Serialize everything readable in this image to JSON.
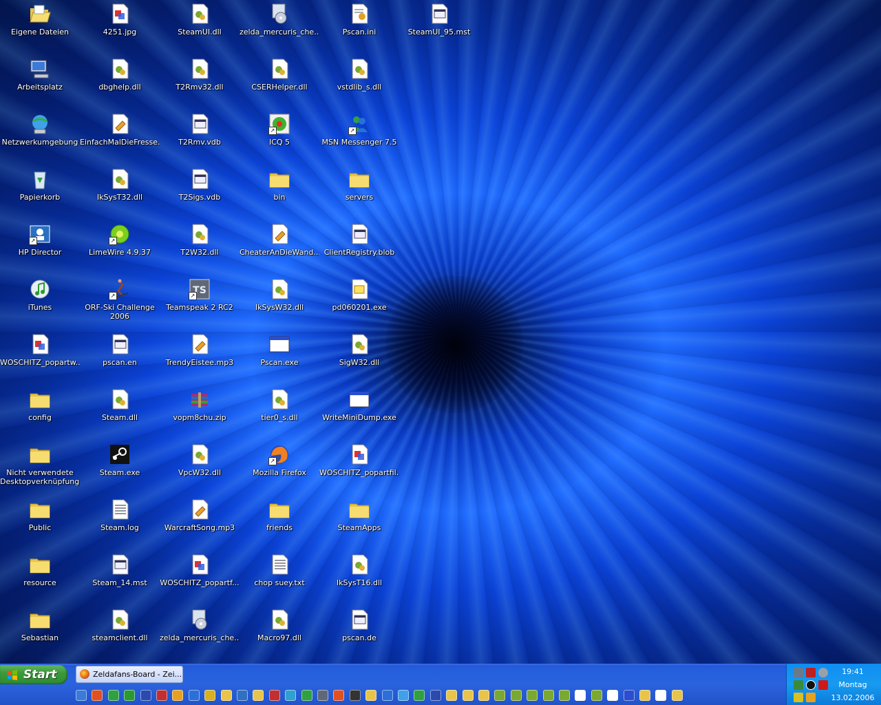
{
  "desktop": {
    "icons": [
      {
        "label": "Eigene Dateien",
        "kind": "folder-open-icon"
      },
      {
        "label": "4251.jpg",
        "kind": "image-file-icon"
      },
      {
        "label": "SteamUI.dll",
        "kind": "dll-file-icon"
      },
      {
        "label": "zelda_mercuris_che...",
        "kind": "installer-icon"
      },
      {
        "label": "Pscan.ini",
        "kind": "ini-file-icon"
      },
      {
        "label": "SteamUI_95.mst",
        "kind": "generic-file-icon"
      },
      {
        "label": "Arbeitsplatz",
        "kind": "my-computer-icon"
      },
      {
        "label": "dbghelp.dll",
        "kind": "dll-file-icon"
      },
      {
        "label": "T2Rmv32.dll",
        "kind": "dll-file-icon"
      },
      {
        "label": "CSERHelper.dll",
        "kind": "dll-file-icon"
      },
      {
        "label": "vstdlib_s.dll",
        "kind": "dll-file-icon"
      },
      {
        "label": "Netzwerkumgebung",
        "kind": "network-icon"
      },
      {
        "label": "EinfachMalDieFresse...",
        "kind": "mp3-file-icon"
      },
      {
        "label": "T2Rmv.vdb",
        "kind": "generic-file-icon"
      },
      {
        "label": "ICQ 5",
        "kind": "icq-icon"
      },
      {
        "label": "MSN Messenger 7.5",
        "kind": "msn-icon"
      },
      {
        "label": "Papierkorb",
        "kind": "recycle-bin-icon"
      },
      {
        "label": "IkSysT32.dll",
        "kind": "dll-file-icon"
      },
      {
        "label": "T2Sigs.vdb",
        "kind": "generic-file-icon"
      },
      {
        "label": "bin",
        "kind": "folder-icon"
      },
      {
        "label": "servers",
        "kind": "folder-icon"
      },
      {
        "label": "HP Director",
        "kind": "hp-director-icon"
      },
      {
        "label": "LimeWire 4.9.37",
        "kind": "limewire-icon"
      },
      {
        "label": "T2W32.dll",
        "kind": "dll-file-icon"
      },
      {
        "label": "CheaterAnDieWand...",
        "kind": "mp3-file-icon"
      },
      {
        "label": "ClientRegistry.blob",
        "kind": "generic-file-icon"
      },
      {
        "label": "iTunes",
        "kind": "itunes-icon"
      },
      {
        "label": "ORF-Ski Challenge\n2006",
        "kind": "skier-icon"
      },
      {
        "label": "Teamspeak 2 RC2",
        "kind": "teamspeak-icon"
      },
      {
        "label": "IkSysW32.dll",
        "kind": "dll-file-icon"
      },
      {
        "label": "pd060201.exe",
        "kind": "exe-file-icon"
      },
      {
        "label": "WOSCHITZ_popartw...",
        "kind": "image-file-icon"
      },
      {
        "label": "pscan.en",
        "kind": "generic-file-icon"
      },
      {
        "label": "TrendyEistee.mp3",
        "kind": "mp3-file-icon"
      },
      {
        "label": "Pscan.exe",
        "kind": "window-exe-icon"
      },
      {
        "label": "SigW32.dll",
        "kind": "dll-file-icon"
      },
      {
        "label": "config",
        "kind": "folder-icon"
      },
      {
        "label": "Steam.dll",
        "kind": "dll-file-icon"
      },
      {
        "label": "vopm8chu.zip",
        "kind": "zip-file-icon"
      },
      {
        "label": "tier0_s.dll",
        "kind": "dll-file-icon"
      },
      {
        "label": "WriteMiniDump.exe",
        "kind": "window-exe-icon"
      },
      {
        "label": "Nicht verwendete\nDesktopverknüpfungen",
        "kind": "folder-icon"
      },
      {
        "label": "Steam.exe",
        "kind": "steam-icon"
      },
      {
        "label": "VpcW32.dll",
        "kind": "dll-file-icon"
      },
      {
        "label": "Mozilla Firefox",
        "kind": "firefox-icon"
      },
      {
        "label": "WOSCHITZ_popartfil...",
        "kind": "image-file-icon"
      },
      {
        "label": "Public",
        "kind": "folder-icon"
      },
      {
        "label": "Steam.log",
        "kind": "text-file-icon"
      },
      {
        "label": "WarcraftSong.mp3",
        "kind": "mp3-file-icon"
      },
      {
        "label": "friends",
        "kind": "folder-icon"
      },
      {
        "label": "SteamApps",
        "kind": "folder-icon"
      },
      {
        "label": "resource",
        "kind": "folder-icon"
      },
      {
        "label": "Steam_14.mst",
        "kind": "generic-file-icon"
      },
      {
        "label": "WOSCHITZ_popartf...",
        "kind": "image-file-icon"
      },
      {
        "label": "chop suey.txt",
        "kind": "text-file-icon"
      },
      {
        "label": "IkSysT16.dll",
        "kind": "dll-file-icon"
      },
      {
        "label": "Sebastian",
        "kind": "folder-icon"
      },
      {
        "label": "steamclient.dll",
        "kind": "dll-file-icon"
      },
      {
        "label": "zelda_mercuris_che...",
        "kind": "installer-icon"
      },
      {
        "label": "Macro97.dll",
        "kind": "dll-file-icon"
      },
      {
        "label": "pscan.de",
        "kind": "generic-file-icon"
      }
    ]
  },
  "taskbar": {
    "start_label": "Start",
    "task_button_label": "Zeldafans-Board - Zei...",
    "clock_time": "19:41",
    "clock_day": "Montag",
    "clock_date": "13.02.2006"
  },
  "colors": {
    "taskbar_blue": "#245edb",
    "start_green": "#3c9a3c",
    "tray_blue": "#179bf0"
  }
}
